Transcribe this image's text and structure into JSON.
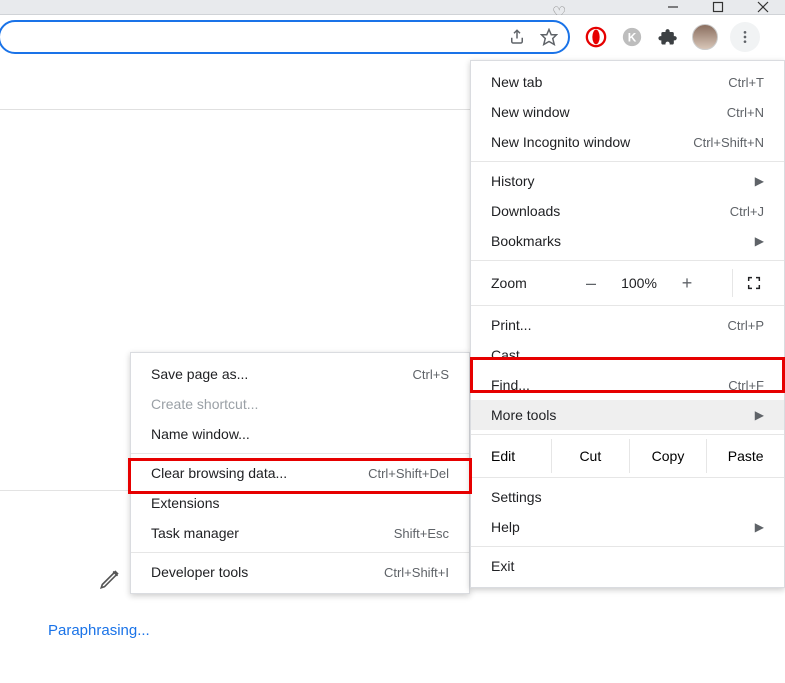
{
  "window": {
    "heart_title_icon": "♡"
  },
  "toolbar": {
    "share_icon": "share",
    "star_icon": "star",
    "ext_opera": "O",
    "ext_k": "K",
    "ext_puzzle": "puzzle"
  },
  "main_menu": {
    "groups": [
      [
        {
          "label": "New tab",
          "shortcut": "Ctrl+T",
          "submenu": false
        },
        {
          "label": "New window",
          "shortcut": "Ctrl+N",
          "submenu": false
        },
        {
          "label": "New Incognito window",
          "shortcut": "Ctrl+Shift+N",
          "submenu": false
        }
      ],
      [
        {
          "label": "History",
          "shortcut": "",
          "submenu": true
        },
        {
          "label": "Downloads",
          "shortcut": "Ctrl+J",
          "submenu": false
        },
        {
          "label": "Bookmarks",
          "shortcut": "",
          "submenu": true
        }
      ],
      [
        {
          "type": "zoom",
          "label": "Zoom",
          "minus": "–",
          "pct": "100%",
          "plus": "+"
        }
      ],
      [
        {
          "label": "Print...",
          "shortcut": "Ctrl+P",
          "submenu": false
        },
        {
          "label": "Cast...",
          "shortcut": "",
          "submenu": false
        },
        {
          "label": "Find...",
          "shortcut": "Ctrl+F",
          "submenu": false
        },
        {
          "label": "More tools",
          "shortcut": "",
          "submenu": true,
          "hovered": true
        }
      ],
      [
        {
          "type": "edit",
          "label": "Edit",
          "cut": "Cut",
          "copy": "Copy",
          "paste": "Paste"
        }
      ],
      [
        {
          "label": "Settings",
          "shortcut": "",
          "submenu": false
        },
        {
          "label": "Help",
          "shortcut": "",
          "submenu": true
        }
      ],
      [
        {
          "label": "Exit",
          "shortcut": "",
          "submenu": false
        }
      ]
    ]
  },
  "sub_menu": {
    "groups": [
      [
        {
          "label": "Save page as...",
          "shortcut": "Ctrl+S"
        },
        {
          "label": "Create shortcut...",
          "shortcut": "",
          "disabled": true
        },
        {
          "label": "Name window...",
          "shortcut": ""
        }
      ],
      [
        {
          "label": "Clear browsing data...",
          "shortcut": "Ctrl+Shift+Del"
        },
        {
          "label": "Extensions",
          "shortcut": ""
        },
        {
          "label": "Task manager",
          "shortcut": "Shift+Esc"
        }
      ],
      [
        {
          "label": "Developer tools",
          "shortcut": "Ctrl+Shift+I"
        }
      ]
    ]
  },
  "page": {
    "paraphrasing": "Paraphrasing..."
  },
  "highlights": {
    "more_tools": true,
    "clear_browsing": true
  }
}
